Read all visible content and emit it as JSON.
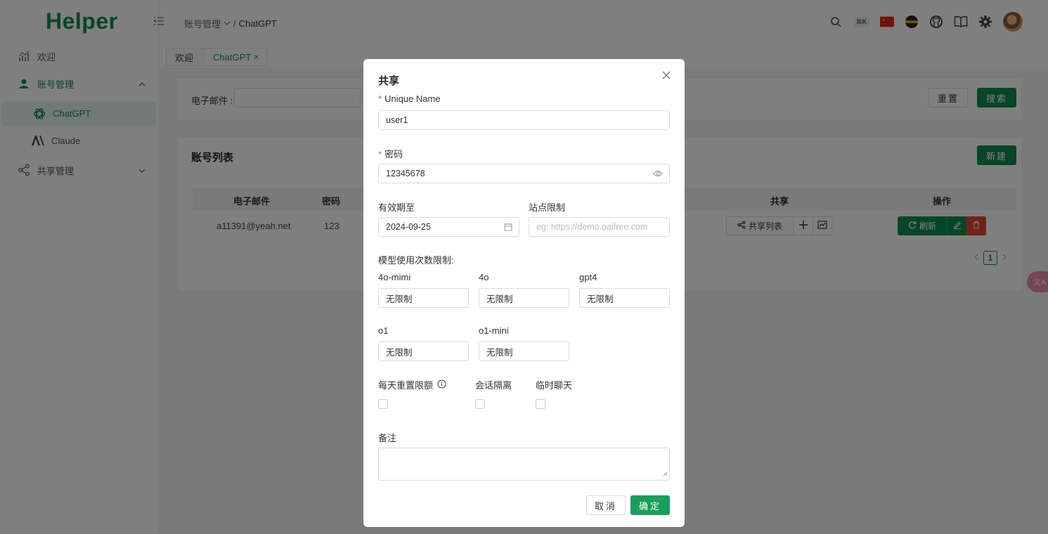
{
  "app": {
    "logo": "Helper"
  },
  "sidebar": {
    "items": [
      {
        "label": "欢迎"
      },
      {
        "label": "账号管理"
      },
      {
        "label": "ChatGPT"
      },
      {
        "label": "Claude"
      },
      {
        "label": "共享管理"
      }
    ]
  },
  "header": {
    "breadcrumb_parent": "账号管理",
    "breadcrumb_sep": "/",
    "breadcrumb_current": "ChatGPT",
    "shortcut_badge": "⌘K"
  },
  "tabs": [
    {
      "label": "欢迎"
    },
    {
      "label": "ChatGPT",
      "close": "×"
    }
  ],
  "search": {
    "label": "电子邮件 :",
    "reset_label": "重置",
    "search_label": "搜索"
  },
  "list": {
    "title": "账号列表",
    "new_label": "新建",
    "columns": [
      "电子邮件",
      "密码",
      "共享",
      "操作"
    ],
    "rows": [
      {
        "email": "a11391@yeah.net",
        "password": "123"
      }
    ],
    "share_list_label": "共享列表",
    "refresh_label": "刷新",
    "page": "1"
  },
  "translate_fab": "文A",
  "modal": {
    "title": "共享",
    "unique_name": {
      "label": "Unique Name",
      "value": "user1"
    },
    "password": {
      "label": "密码",
      "value": "12345678"
    },
    "expiry": {
      "label": "有效期至",
      "value": "2024-09-25"
    },
    "site_limit": {
      "label": "站点限制",
      "placeholder": "eg: https://demo.oaifree.com"
    },
    "model_limits_label": "模型使用次数限制:",
    "models": [
      {
        "label": "4o-mimi",
        "value": "无限制"
      },
      {
        "label": "4o",
        "value": "无限制"
      },
      {
        "label": "gpt4",
        "value": "无限制"
      },
      {
        "label": "o1",
        "value": "无限制"
      },
      {
        "label": "o1-mini",
        "value": "无限制"
      }
    ],
    "checkboxes": [
      {
        "label": "每天重置限额"
      },
      {
        "label": "会话隔离"
      },
      {
        "label": "临时聊天"
      }
    ],
    "note_label": "备注",
    "cancel_label": "取消",
    "confirm_label": "确定"
  },
  "colors": {
    "brand": "#0e8a4f",
    "danger": "#e0442e",
    "overlay": "rgba(0,0,0,0.5)"
  }
}
